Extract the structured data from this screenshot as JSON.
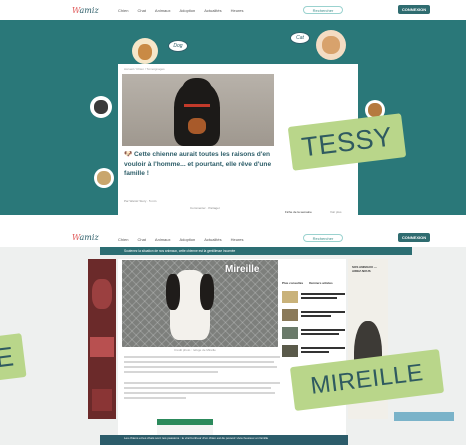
{
  "top_page": {
    "logo": {
      "prefix": "W",
      "rest": "amiz"
    },
    "menu": [
      "Chien",
      "Chat",
      "Animaux",
      "Adoption",
      "Actualités",
      "Heures"
    ],
    "search_label": "Rechercher",
    "connect_label": "CONNEXION",
    "breadcrumb": "Accueil / Chien / Témoignages",
    "bubbles": [
      "Dog",
      "Cat"
    ],
    "headline": "🐶 Cette chienne aurait toutes les raisons d'en vouloir à l'homme... et pourtant, elle rêve d'une famille !",
    "meta": "Par Wamiz Story · 5 min",
    "meta_actions": "Commenter · Partager",
    "sidebar_label": "Fiche de la semaine",
    "sidebar_label_right": "Voir plus"
  },
  "bottom_page": {
    "logo": {
      "prefix": "W",
      "rest": "amiz"
    },
    "menu": [
      "Chien",
      "Chat",
      "Animaux",
      "Adoption",
      "Actualités",
      "Heures"
    ],
    "search_label": "Rechercher",
    "connect_label": "CONNEXION",
    "alert_text": "Soutenez la situation de nos animaux, cette chienne est la gentillesse incarnée",
    "photo_overlay_name": "Mireille",
    "photo_caption": "Crédit photo : refuge de Mireille",
    "sidebar_tabs": [
      "Plus consultés",
      "Derniers articles"
    ],
    "right_ad_label": "SOS ANIMAUX — AIDEZ-NOUS",
    "footer_text": "Les chiens et les chats sont nos passions : le vrai bonheur d'un chien est de pouvoir vivre heureux en famille"
  },
  "name_tags": {
    "tessy": "TESSY",
    "mireille": "MIREILLE",
    "partial": "E"
  }
}
